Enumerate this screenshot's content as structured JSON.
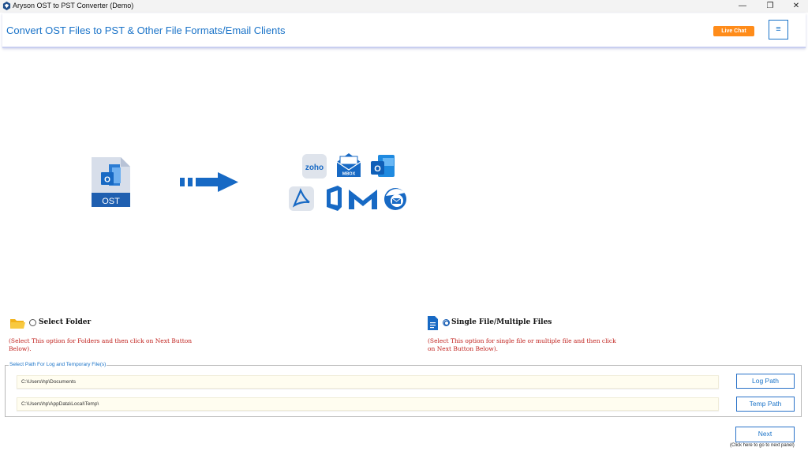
{
  "window": {
    "title": "Aryson OST to PST Converter (Demo)",
    "controls": {
      "minimize": "—",
      "restore": "❐",
      "close": "✕"
    }
  },
  "header": {
    "heading": "Convert OST Files to PST & Other File Formats/Email Clients",
    "live_chat_label": "Live Chat",
    "menu_icon": "≡",
    "accent_color": "#1a73c8",
    "live_chat_color": "#ff8c1a"
  },
  "hero": {
    "source_label": "OST",
    "mbox_label": "MBOX",
    "zoho_label": "zoho"
  },
  "options": {
    "folder": {
      "label": "Select Folder",
      "description": "(Select This option for Folders and then click on Next Button Below).",
      "selected": false
    },
    "file": {
      "label": "Single File/Multiple Files",
      "description": "(Select This option for single file or multiple file and then click on Next Button Below).",
      "selected": true
    }
  },
  "paths": {
    "legend": "Select Path For Log and Temporary File(s)",
    "log_path": "C:\\Users\\hp\\Documents",
    "temp_path": "C:\\Users\\hp\\AppData\\Local\\Temp\\",
    "log_button": "Log Path",
    "temp_button": "Temp Path"
  },
  "footer": {
    "next_button": "Next",
    "next_hint": "(Click here to go to next panel)"
  }
}
